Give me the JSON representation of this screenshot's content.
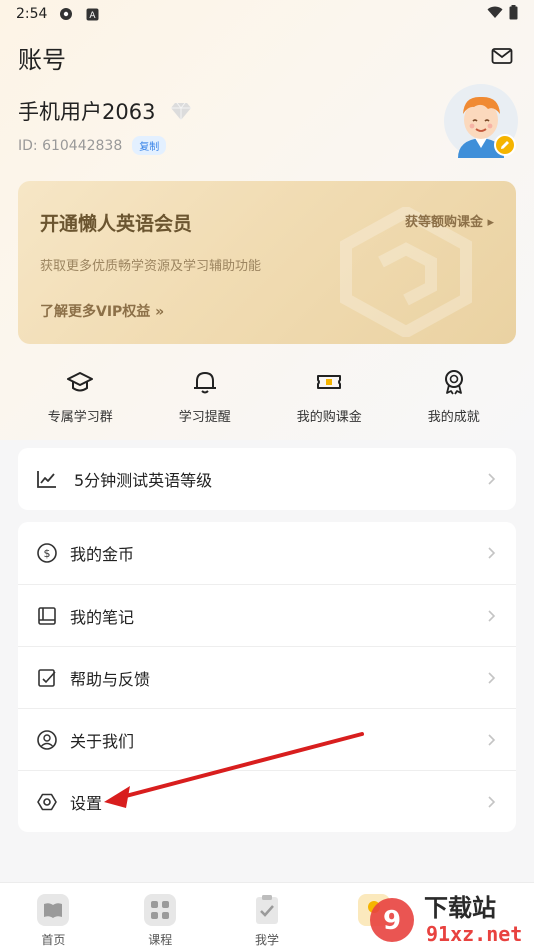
{
  "status_bar": {
    "time": "2:54"
  },
  "header": {
    "title": "账号",
    "mail_icon": "mail-icon"
  },
  "profile": {
    "username": "手机用户2063",
    "user_id": "ID: 610442838",
    "copy_label": "复制"
  },
  "vip": {
    "title": "开通懒人英语会员",
    "subtitle": "获取更多优质畅学资源及学习辅助功能",
    "more": "了解更多VIP权益 »",
    "link": "获等额购课金 ▸"
  },
  "quick_actions": [
    {
      "label": "专属学习群",
      "icon": "graduation-cap-icon"
    },
    {
      "label": "学习提醒",
      "icon": "bell-icon"
    },
    {
      "label": "我的购课金",
      "icon": "ticket-icon"
    },
    {
      "label": "我的成就",
      "icon": "medal-icon"
    }
  ],
  "test_card": {
    "label": "5分钟测试英语等级",
    "icon": "trend-chart-icon"
  },
  "menu": [
    {
      "label": "我的金币",
      "icon": "coin-icon"
    },
    {
      "label": "我的笔记",
      "icon": "notebook-icon"
    },
    {
      "label": "帮助与反馈",
      "icon": "feedback-icon"
    },
    {
      "label": "关于我们",
      "icon": "about-icon"
    },
    {
      "label": "设置",
      "icon": "settings-icon"
    }
  ],
  "tabs": [
    {
      "label": "首页",
      "icon": "home-book-icon"
    },
    {
      "label": "课程",
      "icon": "course-grid-icon"
    },
    {
      "label": "我学",
      "icon": "clipboard-check-icon"
    }
  ],
  "watermark": {
    "text_top": "下载站",
    "text_bottom": "91xz.net"
  },
  "colors": {
    "accent": "#3a84e8",
    "vip_gold": "#f1dcb3",
    "annotation_arrow": "#d81e1e"
  }
}
